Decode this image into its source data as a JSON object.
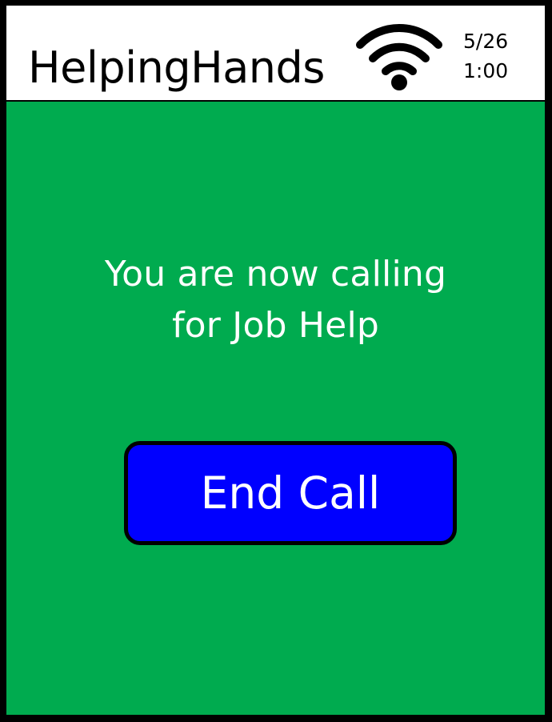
{
  "header": {
    "app_title": "HelpingHands",
    "date": "5/26",
    "time": "1:00",
    "wifi_icon": "wifi-icon"
  },
  "main": {
    "message_line_1": "You are now calling",
    "message_line_2": "for Job Help",
    "end_call_label": "End Call"
  },
  "colors": {
    "background_green": "#00ab4f",
    "button_blue": "#0000ff",
    "header_white": "#ffffff",
    "border_black": "#000000"
  }
}
